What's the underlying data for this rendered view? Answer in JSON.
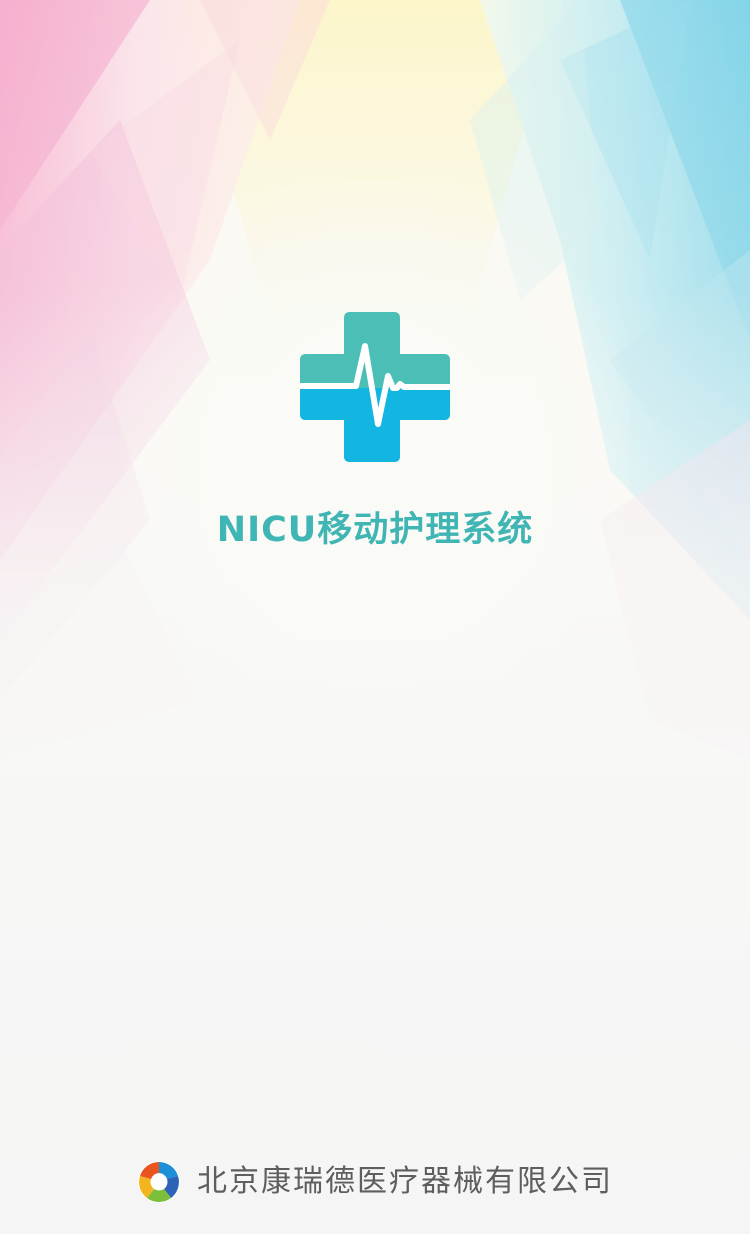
{
  "splash": {
    "app_icon": "medical-cross-heartbeat-icon",
    "app_title": "NICU移动护理系统"
  },
  "footer": {
    "company_logo": "company-logo-icon",
    "company_name": "北京康瑞德医疗器械有限公司"
  },
  "colors": {
    "title": "#3fb5b4",
    "cross_top": "#4bbfb6",
    "cross_bottom": "#13b5e1",
    "company_text": "#5e5e5e"
  }
}
